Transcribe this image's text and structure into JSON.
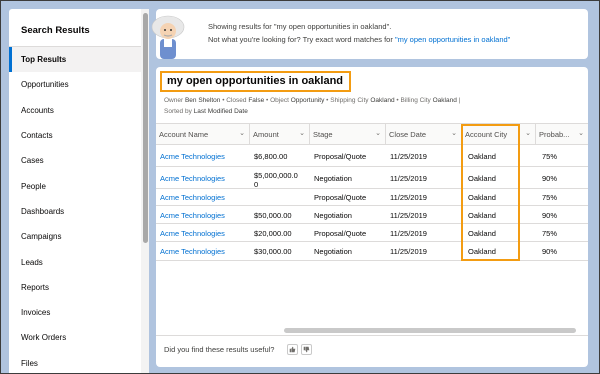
{
  "sidebar": {
    "title": "Search Results",
    "items": [
      {
        "label": "Top Results",
        "active": true
      },
      {
        "label": "Opportunities"
      },
      {
        "label": "Accounts"
      },
      {
        "label": "Contacts"
      },
      {
        "label": "Cases"
      },
      {
        "label": "People"
      },
      {
        "label": "Dashboards"
      },
      {
        "label": "Campaigns"
      },
      {
        "label": "Leads"
      },
      {
        "label": "Reports"
      },
      {
        "label": "Invoices"
      },
      {
        "label": "Work Orders"
      },
      {
        "label": "Files"
      }
    ]
  },
  "banner": {
    "line1": "Showing results for \"my open opportunities in oakland\".",
    "line2_prefix": "Not what you're looking for? Try exact word matches for ",
    "line2_link": "\"my open opportunities in oakland\""
  },
  "results": {
    "title": "my open opportunities in oakland",
    "filter": {
      "owner_label": "Owner",
      "owner_value": "Ben Shelton",
      "closed_label": "Closed",
      "closed_value": "False",
      "object_label": "Object",
      "object_value": "Opportunity",
      "shipping_label": "Shipping City",
      "shipping_value": "Oakland",
      "billing_label": "Billing City",
      "billing_value": "Oakland",
      "sorted_label": "Sorted by",
      "sorted_value": "Last Modified Date"
    },
    "columns": [
      "Account Name",
      "Amount",
      "Stage",
      "Close Date",
      "Account City",
      "Probab..."
    ],
    "rows": [
      {
        "account": "Acme Technologies",
        "amount": "$6,800.00",
        "stage": "Proposal/Quote",
        "close_date": "11/25/2019",
        "city": "Oakland",
        "prob": "75%"
      },
      {
        "account": "Acme Technologies",
        "amount": "$5,000,000.0",
        "amount2": "0",
        "stage": "Negotiation",
        "close_date": "11/25/2019",
        "city": "Oakland",
        "prob": "90%"
      },
      {
        "account": "Acme Technologies",
        "amount": "",
        "stage": "Proposal/Quote",
        "close_date": "11/25/2019",
        "city": "Oakland",
        "prob": "75%"
      },
      {
        "account": "Acme Technologies",
        "amount": "$50,000.00",
        "stage": "Negotiation",
        "close_date": "11/25/2019",
        "city": "Oakland",
        "prob": "90%"
      },
      {
        "account": "Acme Technologies",
        "amount": "$20,000.00",
        "stage": "Proposal/Quote",
        "close_date": "11/25/2019",
        "city": "Oakland",
        "prob": "75%"
      },
      {
        "account": "Acme Technologies",
        "amount": "$30,000.00",
        "stage": "Negotiation",
        "close_date": "11/25/2019",
        "city": "Oakland",
        "prob": "90%"
      }
    ],
    "icons": {
      "caret": "chevron-down-icon",
      "thumbs_up": "thumbs-up-icon",
      "thumbs_down": "thumbs-down-icon"
    }
  },
  "footer": {
    "question": "Did you find these results useful?"
  },
  "colors": {
    "accent_highlight": "#f39c12",
    "link": "#0070d2",
    "background": "#b0c4df"
  }
}
